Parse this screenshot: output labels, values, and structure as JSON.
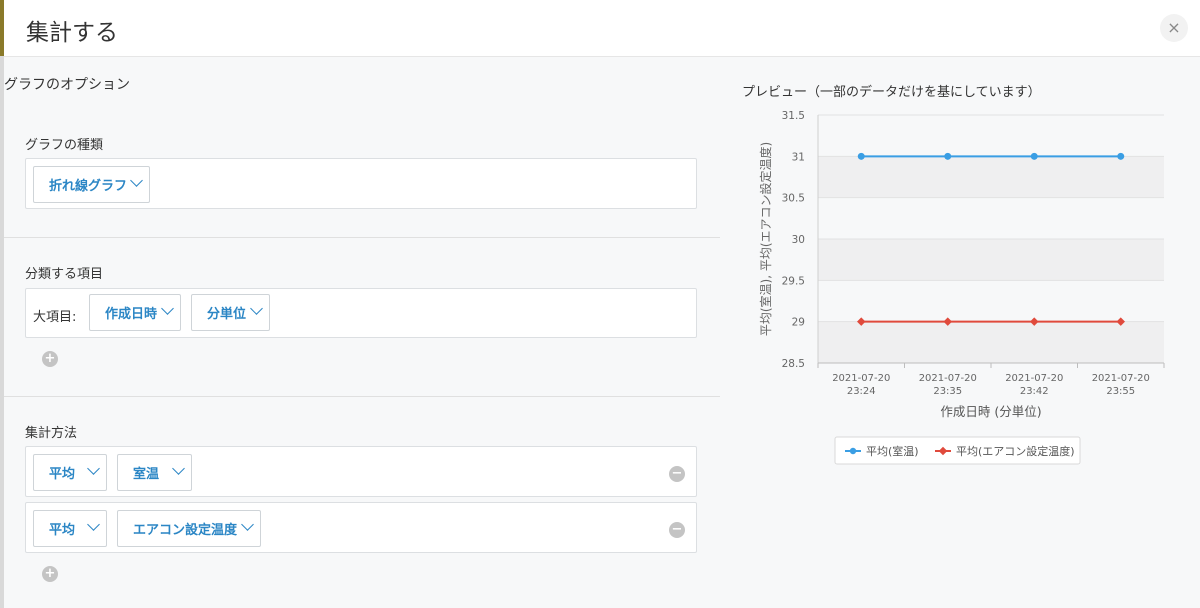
{
  "header": {
    "title": "集計する",
    "close_label": "×"
  },
  "options": {
    "section_title": "グラフのオプション",
    "chart_type": {
      "label": "グラフの種類",
      "value": "折れ線グラフ"
    },
    "grouping": {
      "label": "分類する項目",
      "major_label": "大項目:",
      "field": "作成日時",
      "unit": "分単位",
      "add_label": "+"
    },
    "aggregation": {
      "label": "集計方法",
      "rows": [
        {
          "method": "平均",
          "field": "室温"
        },
        {
          "method": "平均",
          "field": "エアコン設定温度"
        }
      ],
      "add_label": "+",
      "remove_label": "−"
    }
  },
  "preview": {
    "title": "プレビュー（一部のデータだけを基にしています）"
  },
  "chart_data": {
    "type": "line",
    "categories": [
      "2021-07-20 23:24",
      "2021-07-20 23:35",
      "2021-07-20 23:42",
      "2021-07-20 23:55"
    ],
    "series": [
      {
        "name": "平均(室温)",
        "values": [
          31,
          31,
          31,
          31
        ],
        "color": "#3a9ee4"
      },
      {
        "name": "平均(エアコン設定温度)",
        "values": [
          29,
          29,
          29,
          29
        ],
        "color": "#e04a3c"
      }
    ],
    "xlabel": "作成日時 (分単位)",
    "ylabel": "平均(室温), 平均(エアコン設定温度)",
    "ylim": [
      28.5,
      31.5
    ],
    "yticks": [
      "28.5",
      "29",
      "29.5",
      "30",
      "30.5",
      "31",
      "31.5"
    ],
    "legend": "bottom",
    "grid": true
  }
}
